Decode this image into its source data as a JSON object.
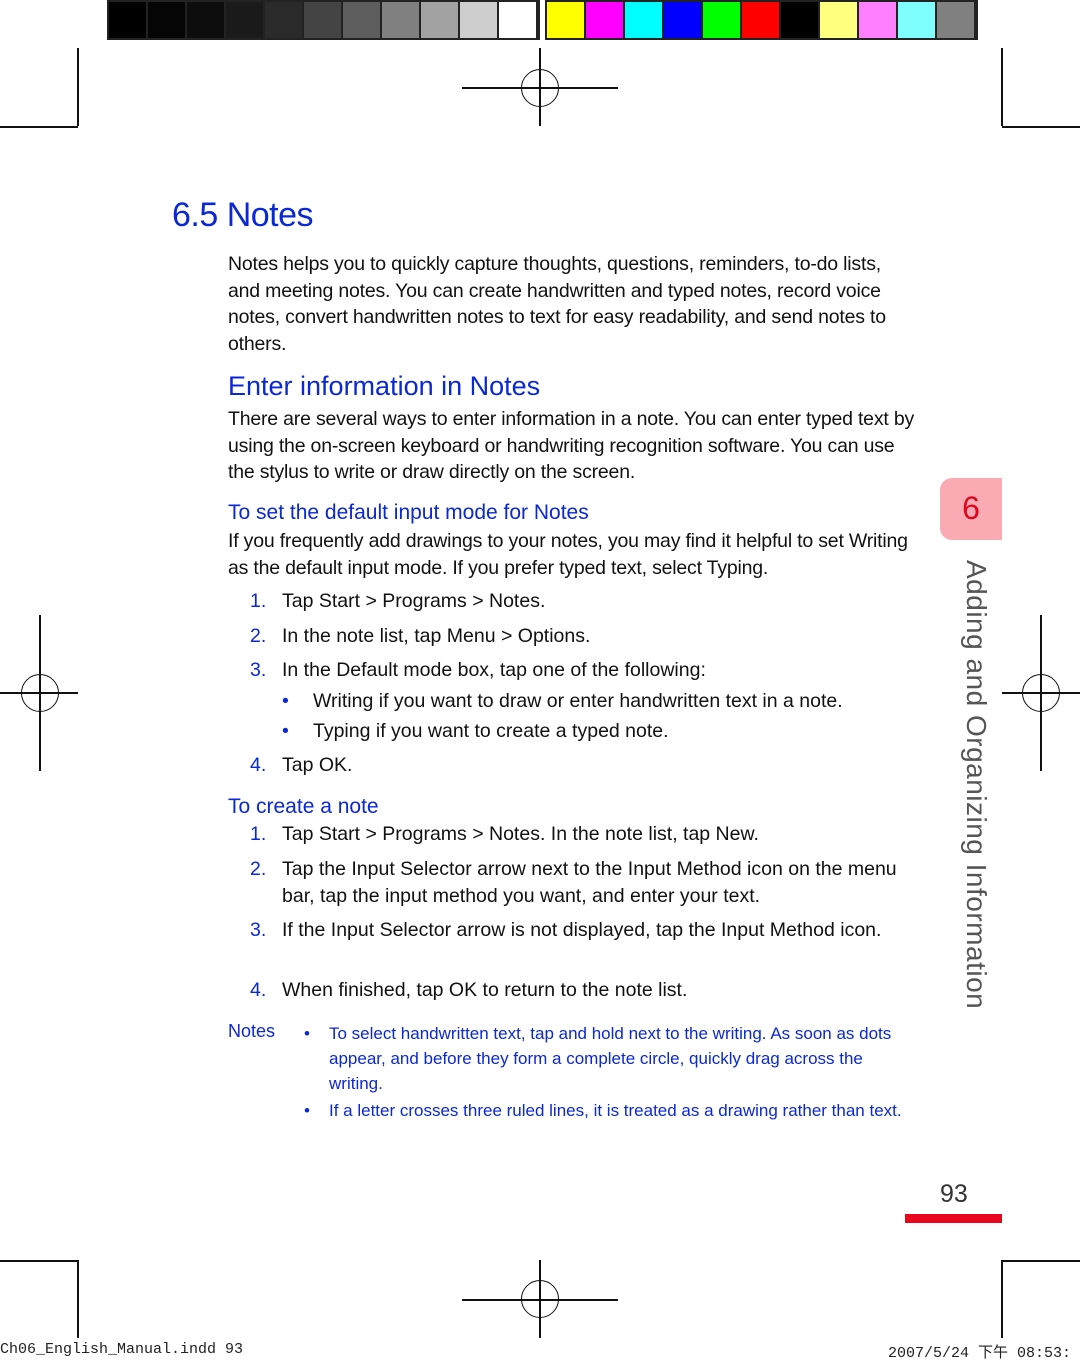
{
  "color_bar": {
    "grays": [
      "#000000",
      "#050505",
      "#0d0d0d",
      "#1a1a1a",
      "#2a2a2a",
      "#444444",
      "#5e5e5e",
      "#808080",
      "#a2a2a2",
      "#cecece",
      "#ffffff"
    ],
    "colors": [
      "#ffff00",
      "#ff00ff",
      "#00ffff",
      "#0000ff",
      "#00ff00",
      "#ff0000",
      "#000000",
      "#ffff80",
      "#ff80ff",
      "#80ffff",
      "#808080"
    ]
  },
  "page": {
    "title": "6.5 Notes",
    "intro": "Notes helps you to quickly capture thoughts, questions, reminders, to-do lists, and meeting notes. You can create handwritten and typed notes, record voice notes, convert handwritten notes to text for easy readability, and send notes to others.",
    "section": {
      "heading": "Enter information in Notes",
      "body": "There are several ways to enter information in a note. You can enter typed text by using the on-screen keyboard or handwriting recognition software. You can use the stylus to write or draw directly on the screen."
    },
    "default_mode": {
      "heading": "To set the default input mode for Notes",
      "body": "If you frequently add drawings to your notes, you may find it helpful to set Writing as the default input mode. If you prefer typed text, select Typing.",
      "steps": [
        {
          "num": "1.",
          "text": "Tap Start > Programs > Notes."
        },
        {
          "num": "2.",
          "text": "In the note list, tap Menu > Options."
        },
        {
          "num": "3.",
          "text": "In the Default mode box, tap one of the following:"
        },
        {
          "num": "4.",
          "text": "Tap OK."
        }
      ],
      "bullets": [
        {
          "dot": "•",
          "text": "Writing if you want to draw or enter handwritten text in a note."
        },
        {
          "dot": "•",
          "text": "Typing if you want to create a typed note."
        }
      ]
    },
    "create_note": {
      "heading": "To create a note",
      "steps": [
        {
          "num": "1.",
          "text": "Tap Start > Programs > Notes. In the note list, tap New."
        },
        {
          "num": "2.",
          "text": "Tap the Input Selector arrow next to the Input Method icon on the menu bar, tap the input method you want, and enter your text."
        },
        {
          "num": "3.",
          "text": "If the Input Selector arrow is not displayed, tap the Input Method icon."
        },
        {
          "num": "4.",
          "text": "When finished, tap OK to return to the note list."
        }
      ]
    },
    "notes_box": {
      "label": "Notes",
      "items": [
        {
          "dot": "•",
          "text": "To select handwritten text, tap and hold next to the writing. As soon as dots appear, and before they form a complete circle, quickly drag across the writing."
        },
        {
          "dot": "•",
          "text": "If a letter crosses three ruled lines, it is treated as a drawing rather than text."
        }
      ]
    },
    "chapter_tab": {
      "number": "6",
      "title": "Adding and Organizing Information"
    },
    "page_number": "93"
  },
  "slug": {
    "left": "Ch06_English_Manual.indd   93",
    "right": "2007/5/24   下午 08:53:"
  }
}
